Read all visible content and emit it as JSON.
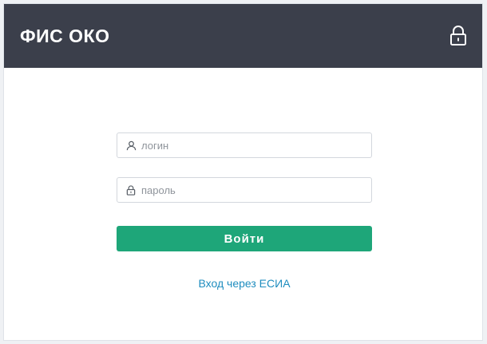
{
  "header": {
    "title": "ФИС ОКО",
    "lock_icon": "lock-icon"
  },
  "form": {
    "login": {
      "placeholder": "логин",
      "value": "",
      "icon": "user-icon"
    },
    "password": {
      "placeholder": "пароль",
      "value": "",
      "icon": "lock-icon"
    },
    "submit_label": "Войти",
    "esia_link": "Вход через ЕСИА"
  },
  "colors": {
    "header_bg": "#3b3f4b",
    "primary_button": "#1ea679",
    "link": "#1f8dbf"
  }
}
